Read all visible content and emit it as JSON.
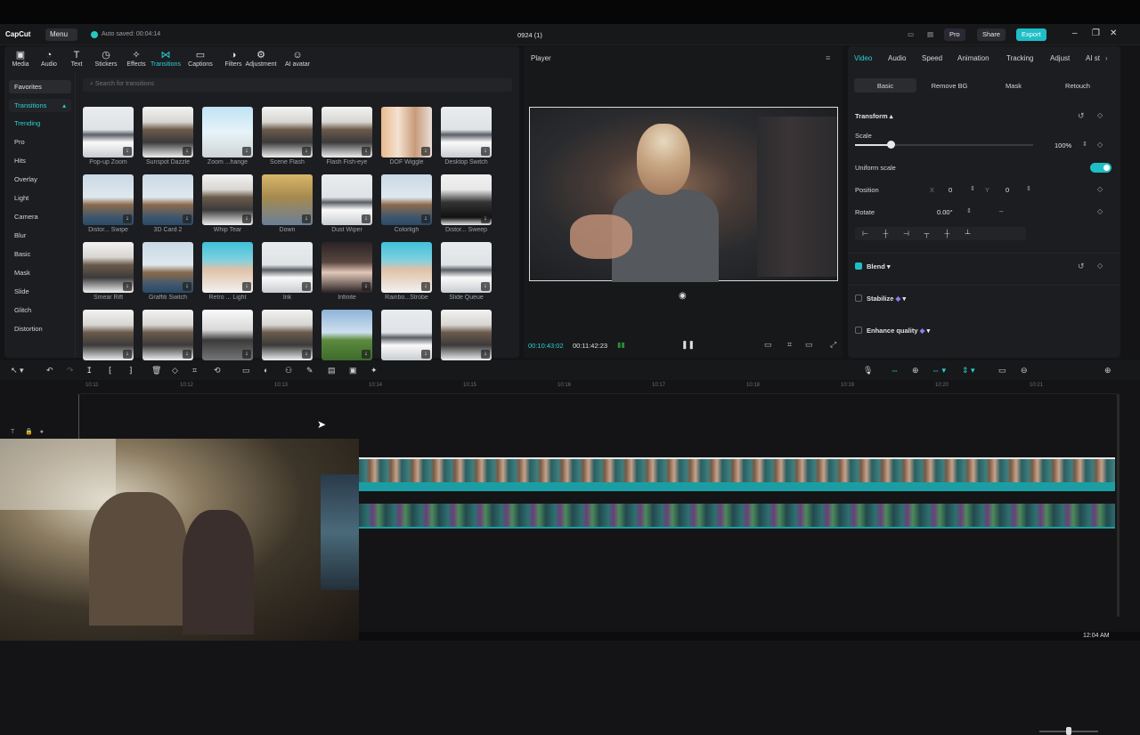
{
  "app": {
    "logo": "CapCut",
    "menu": "Menu",
    "autosave": "Auto saved: 00:04:14",
    "project": "0924 (1)"
  },
  "title_buttons": {
    "pro": "Pro",
    "share": "Share",
    "export": "Export"
  },
  "toolbar": [
    {
      "label": "Media",
      "icon": "media-icon"
    },
    {
      "label": "Audio",
      "icon": "audio-icon"
    },
    {
      "label": "Text",
      "icon": "text-icon"
    },
    {
      "label": "Stickers",
      "icon": "stickers-icon"
    },
    {
      "label": "Effects",
      "icon": "effects-icon"
    },
    {
      "label": "Transitions",
      "icon": "transitions-icon"
    },
    {
      "label": "Captions",
      "icon": "captions-icon"
    },
    {
      "label": "Filters",
      "icon": "filters-icon"
    },
    {
      "label": "Adjustment",
      "icon": "adjustment-icon"
    },
    {
      "label": "AI avatar",
      "icon": "ai-avatar-icon"
    }
  ],
  "categories": {
    "favorites": "Favorites",
    "transitions": "Transitions",
    "items": [
      "Trending",
      "Pro",
      "Hits",
      "Overlay",
      "Light",
      "Camera",
      "Blur",
      "Basic",
      "Mask",
      "Slide",
      "Glitch",
      "Distortion"
    ]
  },
  "search": {
    "placeholder": "Search for transitions"
  },
  "transitions": [
    {
      "name": "Pop-up Zoom",
      "style": "t-mtn"
    },
    {
      "name": "Sunspot Dazzle",
      "style": "t-man"
    },
    {
      "name": "Zoom ...hange",
      "style": "t-sky"
    },
    {
      "name": "Scene Flash",
      "style": "t-man"
    },
    {
      "name": "Flash Fish-eye",
      "style": "t-man"
    },
    {
      "name": "DOF Wiggle",
      "style": "t-blur"
    },
    {
      "name": "Desktop Switch",
      "style": "t-mtn"
    },
    {
      "name": "Distor... Swipe",
      "style": "t-tower"
    },
    {
      "name": "3D Card 2",
      "style": "t-tower"
    },
    {
      "name": "Whip Tear",
      "style": "t-man"
    },
    {
      "name": "Down",
      "style": "t-cliff"
    },
    {
      "name": "Dust Wiper",
      "style": "t-mtn"
    },
    {
      "name": "Colorligh",
      "style": "t-tower"
    },
    {
      "name": "Distor... Sweep",
      "style": "t-suit"
    },
    {
      "name": "Smear Rift",
      "style": "t-man"
    },
    {
      "name": "Graffiti Switch",
      "style": "t-tower"
    },
    {
      "name": "Retro ... Light",
      "style": "t-girl"
    },
    {
      "name": "Ink",
      "style": "t-mtn"
    },
    {
      "name": "Infinite",
      "style": "t-dark"
    },
    {
      "name": "Rainbo...Strobe",
      "style": "t-girl"
    },
    {
      "name": "Slide Queue",
      "style": "t-mtn"
    },
    {
      "name": "",
      "style": "t-man"
    },
    {
      "name": "",
      "style": "t-man"
    },
    {
      "name": "",
      "style": "t-city"
    },
    {
      "name": "",
      "style": "t-man"
    },
    {
      "name": "",
      "style": "t-field"
    },
    {
      "name": "",
      "style": "t-mtn"
    },
    {
      "name": "",
      "style": "t-man"
    }
  ],
  "player": {
    "title": "Player",
    "current": "00:10:43:02",
    "total": "00:11:42:23"
  },
  "inspector": {
    "tabs": [
      "Video",
      "Audio",
      "Speed",
      "Animation",
      "Tracking",
      "Adjust",
      "AI st"
    ],
    "subtabs": [
      "Basic",
      "Remove BG",
      "Mask",
      "Retouch"
    ],
    "transform": "Transform",
    "scale_label": "Scale",
    "scale_value": "100%",
    "scale_level": 0.2,
    "uniform_scale": "Uniform scale",
    "position_label": "Position",
    "pos_x_label": "X",
    "pos_x": "0",
    "pos_y_label": "Y",
    "pos_y": "0",
    "rotate_label": "Rotate",
    "rotate_value": "0.00°",
    "blend": "Blend",
    "stabilize": "Stabilize",
    "enhance": "Enhance quality"
  },
  "ruler": [
    "10:11",
    "10:12",
    "10:13",
    "10:14",
    "10:15",
    "10:16",
    "10:17",
    "10:18",
    "10:19",
    "10:20",
    "10:21"
  ],
  "taskbar": {
    "clock": "12:04 AM"
  }
}
